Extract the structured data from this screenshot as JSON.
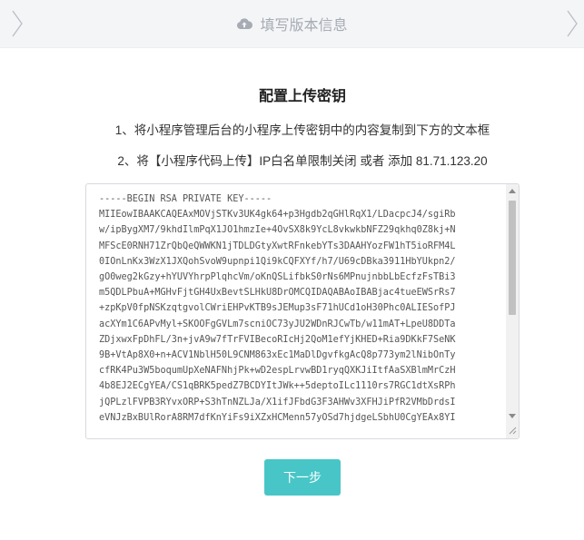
{
  "step_bar": {
    "icon": "cloud-upload-icon",
    "title": "填写版本信息"
  },
  "main": {
    "heading": "配置上传密钥",
    "instruction_1": "1、将小程序管理后台的小程序上传密钥中的内容复制到下方的文本框",
    "instruction_2": "2、将【小程序代码上传】IP白名单限制关闭 或者 添加 81.71.123.20"
  },
  "key_textarea": {
    "value": "-----BEGIN RSA PRIVATE KEY-----\nMIIEowIBAAKCAQEAxMOVjSTKv3UK4gk64+p3Hgdb2qGHlRqX1/LDacpcJ4/sgiRb\nw/ipBygXM7/9khdIlmPqX1JO1hmzIe+4OvSX8k9YcL8vkwkbNFZ29qkhq0Z8kj+N\nMFScE0RNH71ZrQbQeQWWKN1jTDLDGtyXwtRFnkebYTs3DAAHYozFW1hT5ioRFM4L\n0IOnLnKx3WzX1JXQohSvoW9upnpi1Qi9kCQFXYf/h7/U69cDBka3911HbYUkpn2/\ngO0weg2kGzy+hYUVYhrpPlqhcVm/oKnQSLifbkS0rNs6MPnujnbbLbEcfzFsTBi3\nm5QDLPbuA+MGHvFjtGH4UxBevtSLHkU8DrOMCQIDAQABAoIBABjac4tueEWSrRs7\n+zpKpV0fpNSKzqtgvolCWriEHPvKTB9sJEMup3sF71hUCd1oH30Phc0ALIESofPJ\nacXYm1C6APvMyl+SKOOFgGVLm7scniOC73yJU2WDnRJCwTb/w11mAT+LpeU8DDTa\nZDjxwxFpDhFL/3n+jvA9w7fTrFVIBecoRIcHj2QoM1efYjKHED+Ria9DKkF7SeNK\n9B+VtAp8X0+n+ACV1NblH50L9CNM863xEc1MaDlDgvfkgAcQ8p773ym2lNibOnTy\ncfRK4Pu3W5boqumUpXeNAFNhjPk+wD2espLrvwBD1ryqQXKJiItfAaSXBlmMrCzH\n4b8EJ2ECgYEA/CS1qBRK5pedZ7BCDYItJWk++5deptoILc1110rs7RGC1dtXsRPh\njQPLzlFVPB3RYvxORP+S3hTnNZLJa/X1ifJFbdG3F3AHWv3XFHJiPfR2VMbDrdsI\neVNJzBxBUlRorA8RM7dfKnYiFs9iXZxHCMenn57yOSd7hjdgeLSbhU0CgYEAx8YI"
  },
  "buttons": {
    "next_label": "下一步"
  }
}
